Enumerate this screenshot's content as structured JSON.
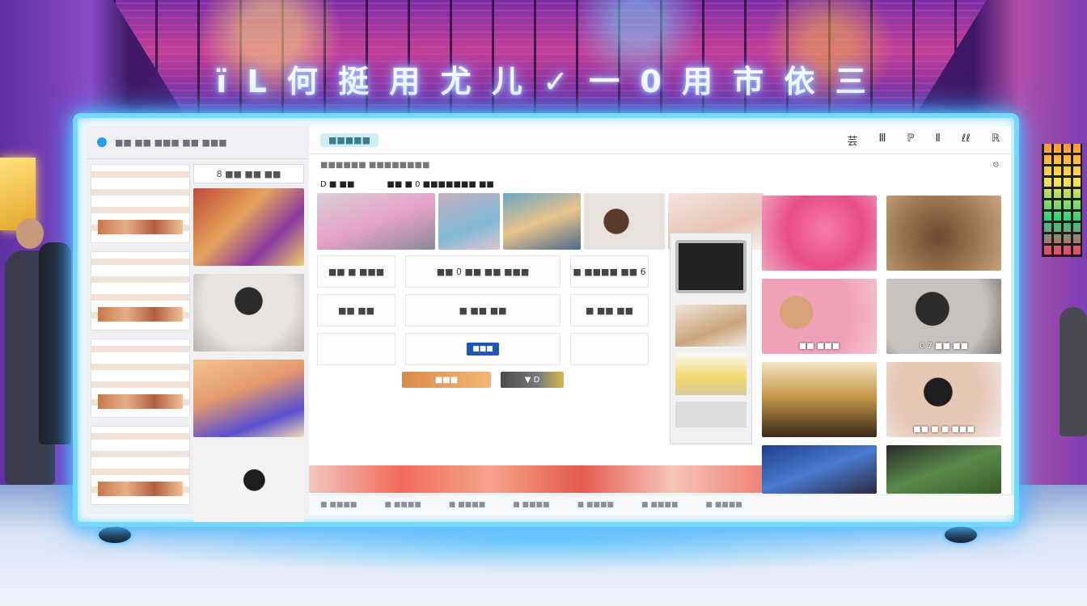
{
  "scene": {
    "sign_text": "ï L 何 挺 用 尤 儿 ✓ 一 0 用 市 依 三",
    "colors": {
      "neon_frame": "#74d8ff",
      "wall": "#5e2fa5",
      "floor": "#d9e4f5"
    }
  },
  "screen": {
    "side_panel": {
      "header_text": "■■ ■■ ■■■ ■■ ■■■",
      "column_b_title": "8 ■■ ■■ ■■"
    },
    "main": {
      "top_tab": "■■■■■",
      "tools": [
        "芸",
        "Ⅲ",
        "ℙ",
        "Ⅱ",
        "ℓℓ",
        "ℝ"
      ],
      "sub_bar_left": "■■■■■■ ■■■■■■■■",
      "crumbs": [
        "D ■ ■■",
        "■■ ■ 0 ■■■■■■■ ■■"
      ],
      "cells": [
        "■■ ■ ■■■",
        "■■ 0 ■■ ■■ ■■■",
        "■ ■■■■ ■■ 6"
      ],
      "cells_row2": [
        "■■ ■■",
        "■ ■■ ■■",
        "■ ■■ ■■"
      ],
      "button_blue": "■■■",
      "button_orange": "■■■",
      "button_dark": "▼ D",
      "photo_captions": [
        "■■ ■■■",
        "■■ ■ ■ ■■■",
        "0 7 ■■ ■■"
      ],
      "footer_items": [
        "■ ■■■■",
        "■ ■■■■",
        "■ ■■■■",
        "■ ■■■■",
        "■ ■■■■",
        "■ ■■■■",
        "■ ■■■■"
      ]
    }
  }
}
